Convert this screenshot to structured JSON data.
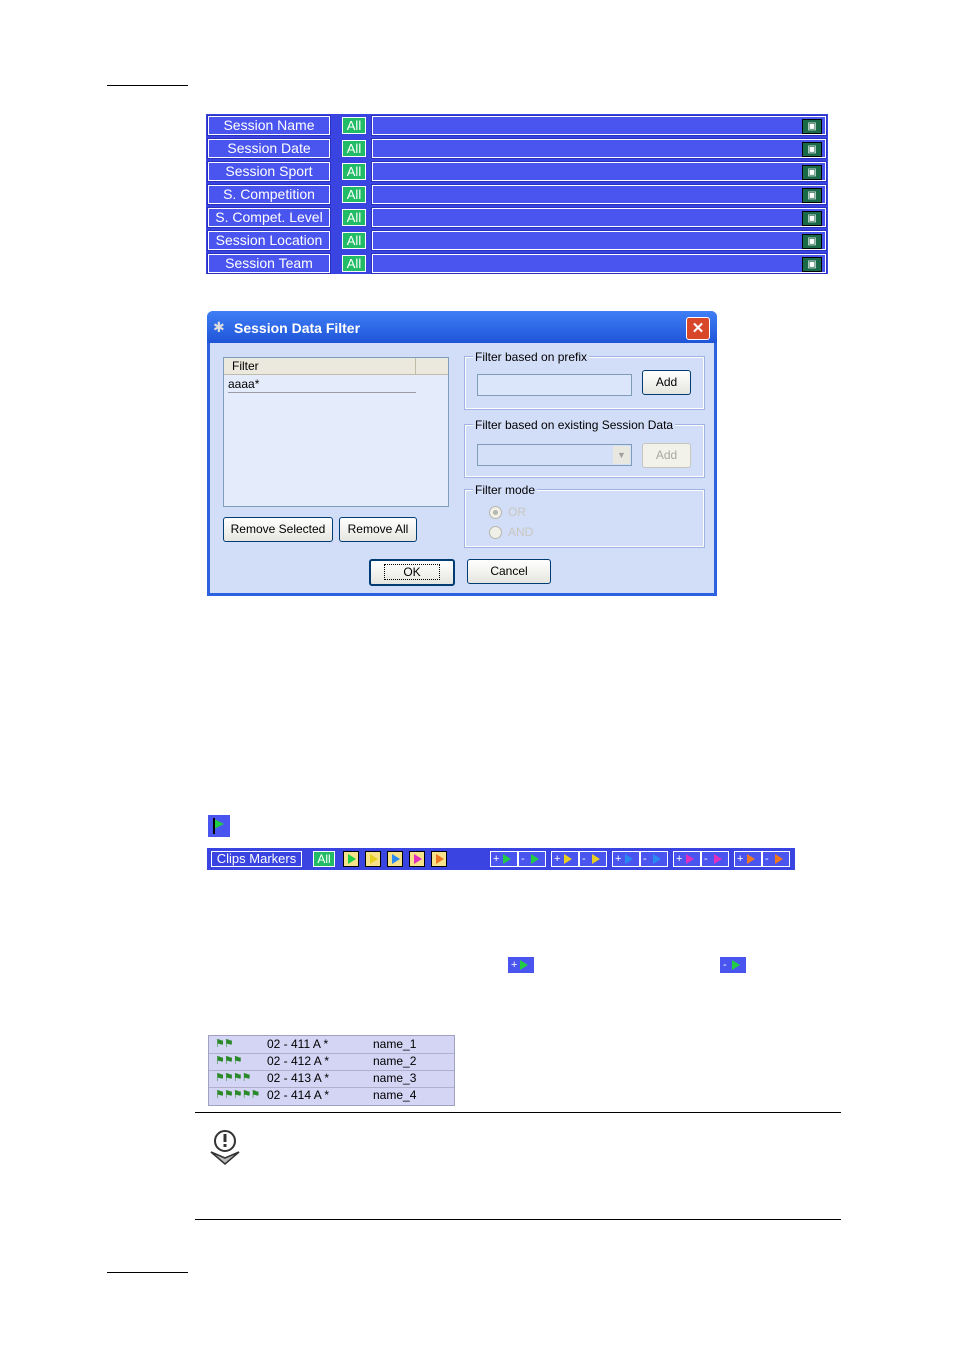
{
  "session_filters": [
    {
      "label": "Session Name",
      "all": "All",
      "icon": "filter-icon"
    },
    {
      "label": "Session Date",
      "all": "All",
      "icon": "filter-icon"
    },
    {
      "label": "Session Sport",
      "all": "All",
      "icon": "filter-icon"
    },
    {
      "label": "S. Competition",
      "all": "All",
      "icon": "filter-icon"
    },
    {
      "label": "S. Compet. Level",
      "all": "All",
      "icon": "filter-icon"
    },
    {
      "label": "Session Location",
      "all": "All",
      "icon": "filter-icon"
    },
    {
      "label": "Session Team",
      "all": "All",
      "icon": "filter-icon"
    }
  ],
  "dialog": {
    "title": "Session Data Filter",
    "list_header": "Filter",
    "list_items": [
      "aaaa*"
    ],
    "remove_selected": "Remove Selected",
    "remove_all": "Remove All",
    "prefix_group": "Filter based on prefix",
    "prefix_add": "Add",
    "existing_group": "Filter based on existing Session Data",
    "existing_add": "Add",
    "mode_group": "Filter mode",
    "mode_or": "OR",
    "mode_and": "AND",
    "ok": "OK",
    "cancel": "Cancel"
  },
  "clips_markers": {
    "label": "Clips Markers",
    "all": "All",
    "marker_colors": [
      "#22cc44",
      "#e8d020",
      "#2a8af0",
      "#e030c0",
      "#f07820"
    ],
    "plus": "+",
    "minus": "-"
  },
  "clip_rows": [
    {
      "id": "02 - 411 A *",
      "name": "name_1"
    },
    {
      "id": "02 - 412 A *",
      "name": "name_2"
    },
    {
      "id": "02 - 413 A *",
      "name": "name_3"
    },
    {
      "id": "02 - 414 A *",
      "name": "name_4"
    }
  ]
}
